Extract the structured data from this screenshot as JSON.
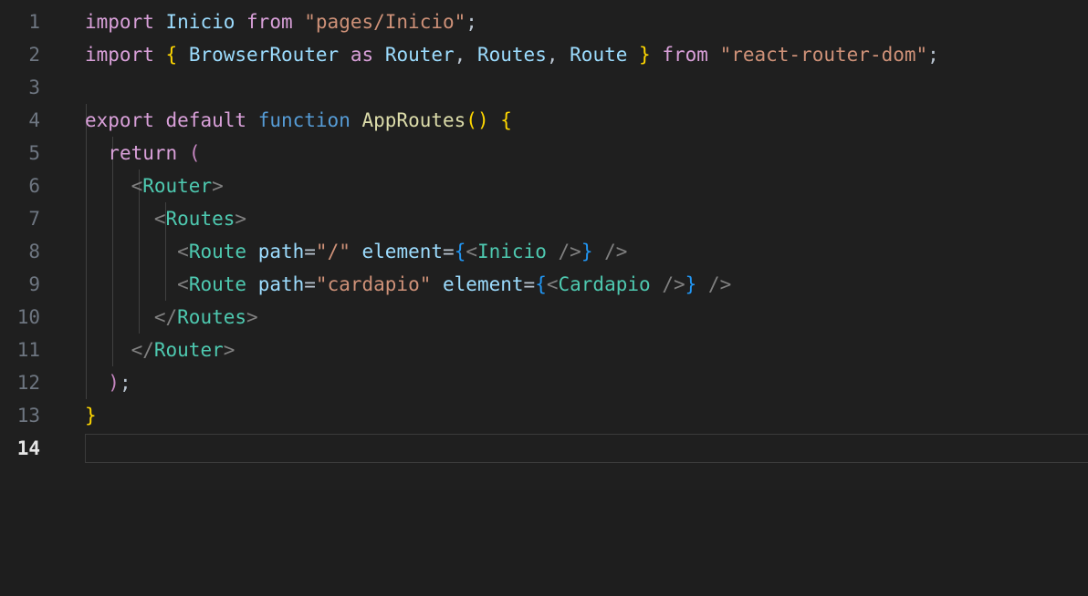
{
  "editor": {
    "background": "#1f1f1f",
    "gutter_color": "#6e7681",
    "active_line_number": 14,
    "total_lines": 14,
    "font_size_px": 21,
    "line_height_px": 36,
    "indent_guide_color": "#404040",
    "active_line_border_color": "#3b3b3b",
    "palette": {
      "keyword": "#d9a0d9",
      "identifier": "#9cdcfe",
      "string": "#ce9178",
      "brace_yellow": "#ffd700",
      "function_name": "#dcdcaa",
      "function_keyword": "#569cd6",
      "jsx_tag": "#4ec9b0",
      "punctuation": "#808080",
      "jsx_brace": "#2196f3",
      "operator": "#b9c4d0",
      "return_paren": "#c586c0"
    },
    "lines": [
      {
        "n": 1,
        "text": "import Inicio from \"pages/Inicio\";"
      },
      {
        "n": 2,
        "text": "import { BrowserRouter as Router, Routes, Route } from \"react-router-dom\";"
      },
      {
        "n": 3,
        "text": ""
      },
      {
        "n": 4,
        "text": "export default function AppRoutes() {"
      },
      {
        "n": 5,
        "text": "  return ("
      },
      {
        "n": 6,
        "text": "    <Router>"
      },
      {
        "n": 7,
        "text": "      <Routes>"
      },
      {
        "n": 8,
        "text": "        <Route path=\"/\" element={<Inicio />} />"
      },
      {
        "n": 9,
        "text": "        <Route path=\"cardapio\" element={<Cardapio />} />"
      },
      {
        "n": 10,
        "text": "      </Routes>"
      },
      {
        "n": 11,
        "text": "    </Router>"
      },
      {
        "n": 12,
        "text": "  );"
      },
      {
        "n": 13,
        "text": "}"
      },
      {
        "n": 14,
        "text": ""
      }
    ],
    "line_numbers": {
      "l1": "1",
      "l2": "2",
      "l3": "3",
      "l4": "4",
      "l5": "5",
      "l6": "6",
      "l7": "7",
      "l8": "8",
      "l9": "9",
      "l10": "10",
      "l11": "11",
      "l12": "12",
      "l13": "13",
      "l14": "14"
    },
    "tokens": {
      "import": "import",
      "from": "from",
      "as": "as",
      "export": "export",
      "default": "default",
      "function": "function",
      "return": "return",
      "inicio": "Inicio",
      "str_pages_inicio": "\"pages/Inicio\"",
      "semi": ";",
      "brace_open": "{",
      "brace_close": "}",
      "browser_router": "BrowserRouter",
      "router": "Router",
      "routes": "Routes",
      "route": "Route",
      "comma": ",",
      "space": " ",
      "str_react_router_dom": "\"react-router-dom\"",
      "app_routes": "AppRoutes",
      "paren_pair": "()",
      "paren_open": "(",
      "paren_close": ")",
      "lt": "<",
      "gt": ">",
      "lt_slash": "</",
      "slash_gt": "/>",
      "path_attr": "path",
      "element_attr": "element",
      "equals": "=",
      "str_slash": "\"/\"",
      "str_cardapio": "\"cardapio\"",
      "cardapio": "Cardapio",
      "indent2": "  ",
      "indent4": "    ",
      "indent6": "      ",
      "indent8": "        "
    }
  }
}
